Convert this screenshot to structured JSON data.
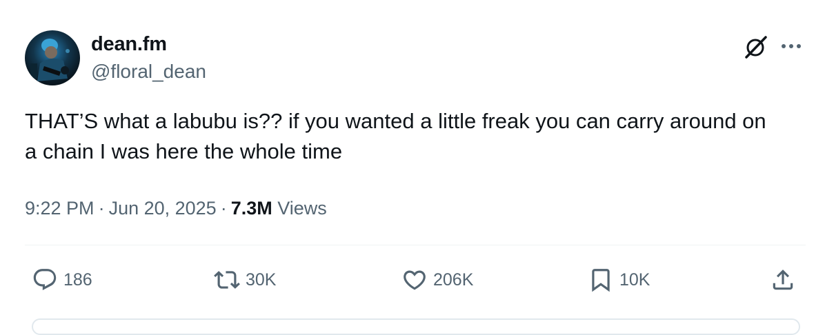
{
  "author": {
    "display_name": "dean.fm",
    "handle": "@floral_dean",
    "avatar": "avatar-photo"
  },
  "tweet": {
    "text": "THAT’S what a labubu is?? if you wanted a little freak you can carry around on a chain I was here the whole time",
    "time": "9:22 PM",
    "date": "Jun 20, 2025",
    "views_count": "7.3M",
    "views_label": "Views",
    "separator": "·"
  },
  "actions": {
    "reply": {
      "icon": "reply-icon",
      "count": "186"
    },
    "repost": {
      "icon": "repost-icon",
      "count": "30K"
    },
    "like": {
      "icon": "heart-icon",
      "count": "206K"
    },
    "bookmark": {
      "icon": "bookmark-icon",
      "count": "10K"
    },
    "share": {
      "icon": "share-icon"
    }
  },
  "header_icons": {
    "grok": "grok-icon",
    "more": "more-icon"
  },
  "colors": {
    "text_primary": "#0f1419",
    "text_secondary": "#536471",
    "divider": "#eff3f4",
    "background": "#ffffff"
  }
}
